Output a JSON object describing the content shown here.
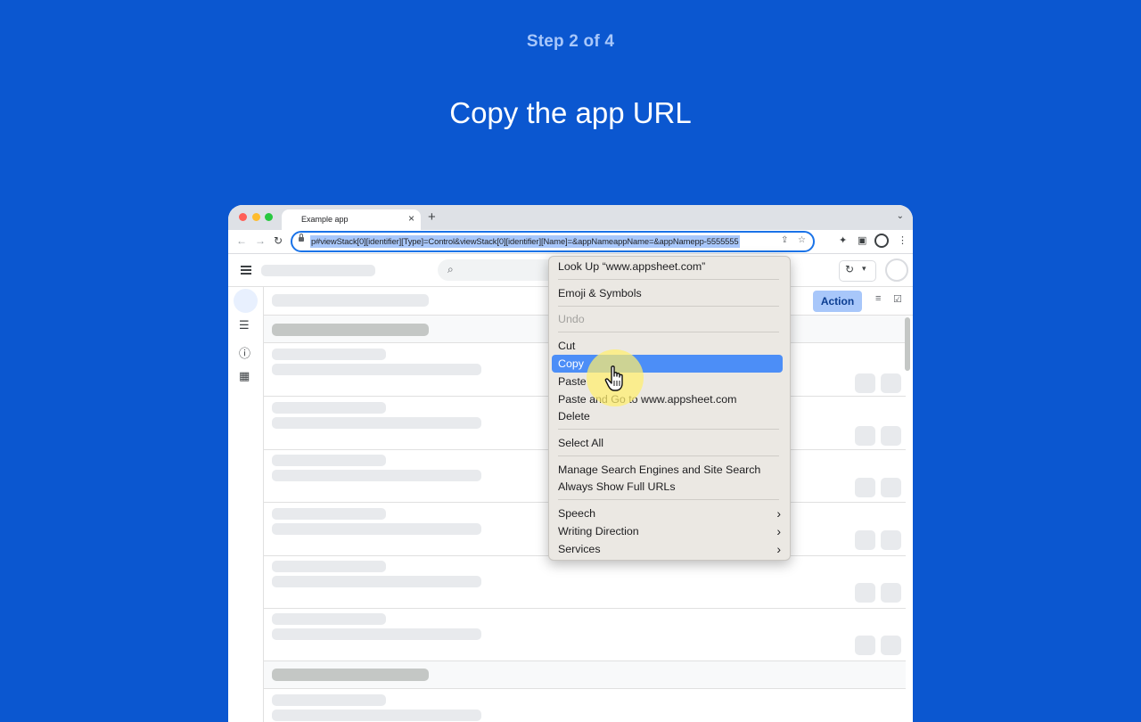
{
  "step_label": "Step 2 of 4",
  "headline": "Copy the app URL",
  "browser": {
    "tab_title": "Example app",
    "tab_close": "×",
    "new_tab": "+",
    "tab_list": "⌄",
    "back": "←",
    "forward": "→",
    "reload": "↻",
    "url_selected": "p#viewStack[0][identifier][Type]=Control&viewStack[0][identifier][Name]=&appNameappName=&appNamepp-5555555",
    "share_icon": "⇪",
    "bookmark_icon": "☆",
    "extensions_icon": "✦",
    "side_panel_icon": "▣",
    "menu_icon": "⋮"
  },
  "app": {
    "action_label": "Action",
    "search_icon": "⌕",
    "sync_icon": "↻",
    "sync_dropdown": "▾",
    "filter_icon": "≡",
    "select_icon": "☑",
    "rail_icons": [
      "☰",
      "ⓘ",
      "▦"
    ]
  },
  "context_menu": {
    "items": [
      {
        "label": "Look Up “www.appsheet.com”"
      },
      {
        "label": "Emoji & Symbols"
      },
      {
        "label": "Undo",
        "disabled": true
      },
      {
        "label": "Cut"
      },
      {
        "label": "Copy",
        "highlighted": true
      },
      {
        "label": "Paste"
      },
      {
        "label": "Paste and Go to www.appsheet.com"
      },
      {
        "label": "Delete"
      },
      {
        "label": "Select All"
      },
      {
        "label": "Manage Search Engines and Site Search"
      },
      {
        "label": "Always Show Full URLs"
      },
      {
        "label": "Speech",
        "submenu": true
      },
      {
        "label": "Writing Direction",
        "submenu": true
      },
      {
        "label": "Services",
        "submenu": true
      }
    ],
    "submenu_glyph": "›"
  },
  "colors": {
    "background": "#0b57d0",
    "step_label": "#a8c7fa",
    "highlight": "#4c8ef7",
    "url_selection": "#a8c7fa"
  }
}
